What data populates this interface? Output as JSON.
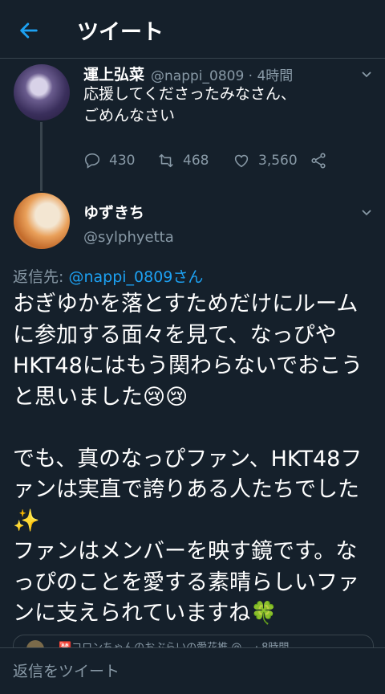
{
  "header": {
    "title": "ツイート"
  },
  "tweet1": {
    "author": "運上弘菜",
    "meta": "@nappi_0809 · 4時間",
    "text": "応援してくださったみなさん、\nごめんなさい",
    "replies": "430",
    "retweets": "468",
    "likes": "3,560"
  },
  "tweet2": {
    "author": "ゆずきち",
    "handle": "@sylphyetta",
    "replying_prefix": "返信先: ",
    "replying_mention": "@nappi_0809さん",
    "text": "おぎゆかを落とすためだけにルームに参加する面々を見て、なっぴやHKT48にはもう関わらないでおこうと思いました😢😢\n\nでも、真のなっぴファン、HKT48ファンは実直で誇りある人たちでした✨\nファンはメンバーを映す鏡です。なっぴのことを愛する素晴らしいファンに支えられていますね🍀"
  },
  "quote": {
    "text": "🈲コロンちゃんのおぶらいの愛花推 @... · 8時間"
  },
  "composer": {
    "placeholder": "返信をツイート"
  },
  "colors": {
    "background": "#15202b",
    "accent": "#1da1f2",
    "secondary_text": "#8899a6",
    "divider": "#38444d"
  }
}
